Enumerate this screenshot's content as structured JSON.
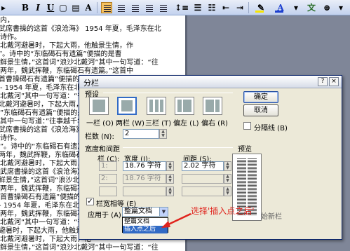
{
  "toolbar": {
    "bold": "B",
    "italic": "I",
    "underline": "U",
    "font_color_glyph": "A",
    "char_scale_glyph": "A",
    "font_color": "#1c3fcf",
    "highlight_color": "#f7e600"
  },
  "document": {
    "lines": [
      "内，",
      "武席書操的这首《浪沧海》 1954 年夏，毛泽东在北",
      "诗作。",
      "北戴河避暑时，下起大雨，他触景生情，作",
      "”。诗中的“东临碣石有遗篇”便描的是曹",
      "鲜景生情，”这首词“浪沙北戴河”其中一句写道：“往",
      "两年，魏武挥鞭，东临碣石有遗篇。”这首中",
      "首曹操碣石有遗篇”便描的是曹操所写的诗：",
      "- 1954 年夏，毛泽东在北戴河避暑时，下起大雨，他",
      "北戴河”其中一句写道：“往",
      "北戴河避暑时，下起大雨，他",
      "”东临碣石有遗篇“便描的是曹",
      "其中一句写道：”往事越千年，魏武挥鞭，东临",
      "武席書操的这首《浪沧海》 1954 年夏，毛泽东在北",
      "诗作。",
      "”。诗中的“东临碣石有遗篇”便描的是曹",
      "两年，魏武挥鞭，东临碣石有遗篇。”这首中",
      "北戴河避暑时，下起大雨，他触景生情，作",
      "武席書操的这首《浪沧海》 1954 年夏，毛泽东在北",
      "鲜景生情，”这首词“浪沙北戴河”其中一句写道：“往",
      "两年，魏武挥鞭，东临碣石有遗篇。”这首中",
      "首曹操碣石有遗篇”便描的是曹操所写的诗：",
      "- 1954 年夏，毛泽东在北戴河避暑时，下起大雨，他",
      "两年，魏武挥鞭，东临碣石有遗篇。”这首中",
      "北戴河”其中一句写道：“往",
      "避暑时，下起大雨，他触景生",
      "北戴河避暑时，下起大雨，他",
      "鲜景生情，”这首词“浪沙北戴河”其中一句写道：“往"
    ]
  },
  "dialog": {
    "title": "分栏",
    "help_button": "?",
    "close_button": "×",
    "ok": "确定",
    "cancel": "取消",
    "presets_label": "预设",
    "presets": [
      "一栏 (O)",
      "两栏 (W)",
      "三栏 (T)",
      "偏左 (L)",
      "偏右 (R)"
    ],
    "column_count_label": "栏数 (N):",
    "column_count": "2",
    "line_between_label": "分隔线 (B)",
    "width_spacing_label": "宽度和间距",
    "col_header": "栏 (C):",
    "width_header": "宽度 (I):",
    "spacing_header": "间距 (S):",
    "row1_num": "1:",
    "row1_width": "18.76 字符",
    "row1_spacing": "2.02 字符",
    "row2_num": "2:",
    "row2_width": "18.76 字符",
    "equal_width_label": "栏宽相等 (E)",
    "preview_label": "预览",
    "apply_to_label": "应用于 (A):",
    "apply_to_value": "整篇文档",
    "dropdown_options": [
      "整篇文档",
      "插入点之后"
    ],
    "new_column_label": "开始新栏"
  },
  "annotation": "选择'插入点之后'",
  "colors": {
    "annotation": "#e0231c",
    "selection": "#316ac5",
    "dialog_bg": "#ece9d8"
  }
}
